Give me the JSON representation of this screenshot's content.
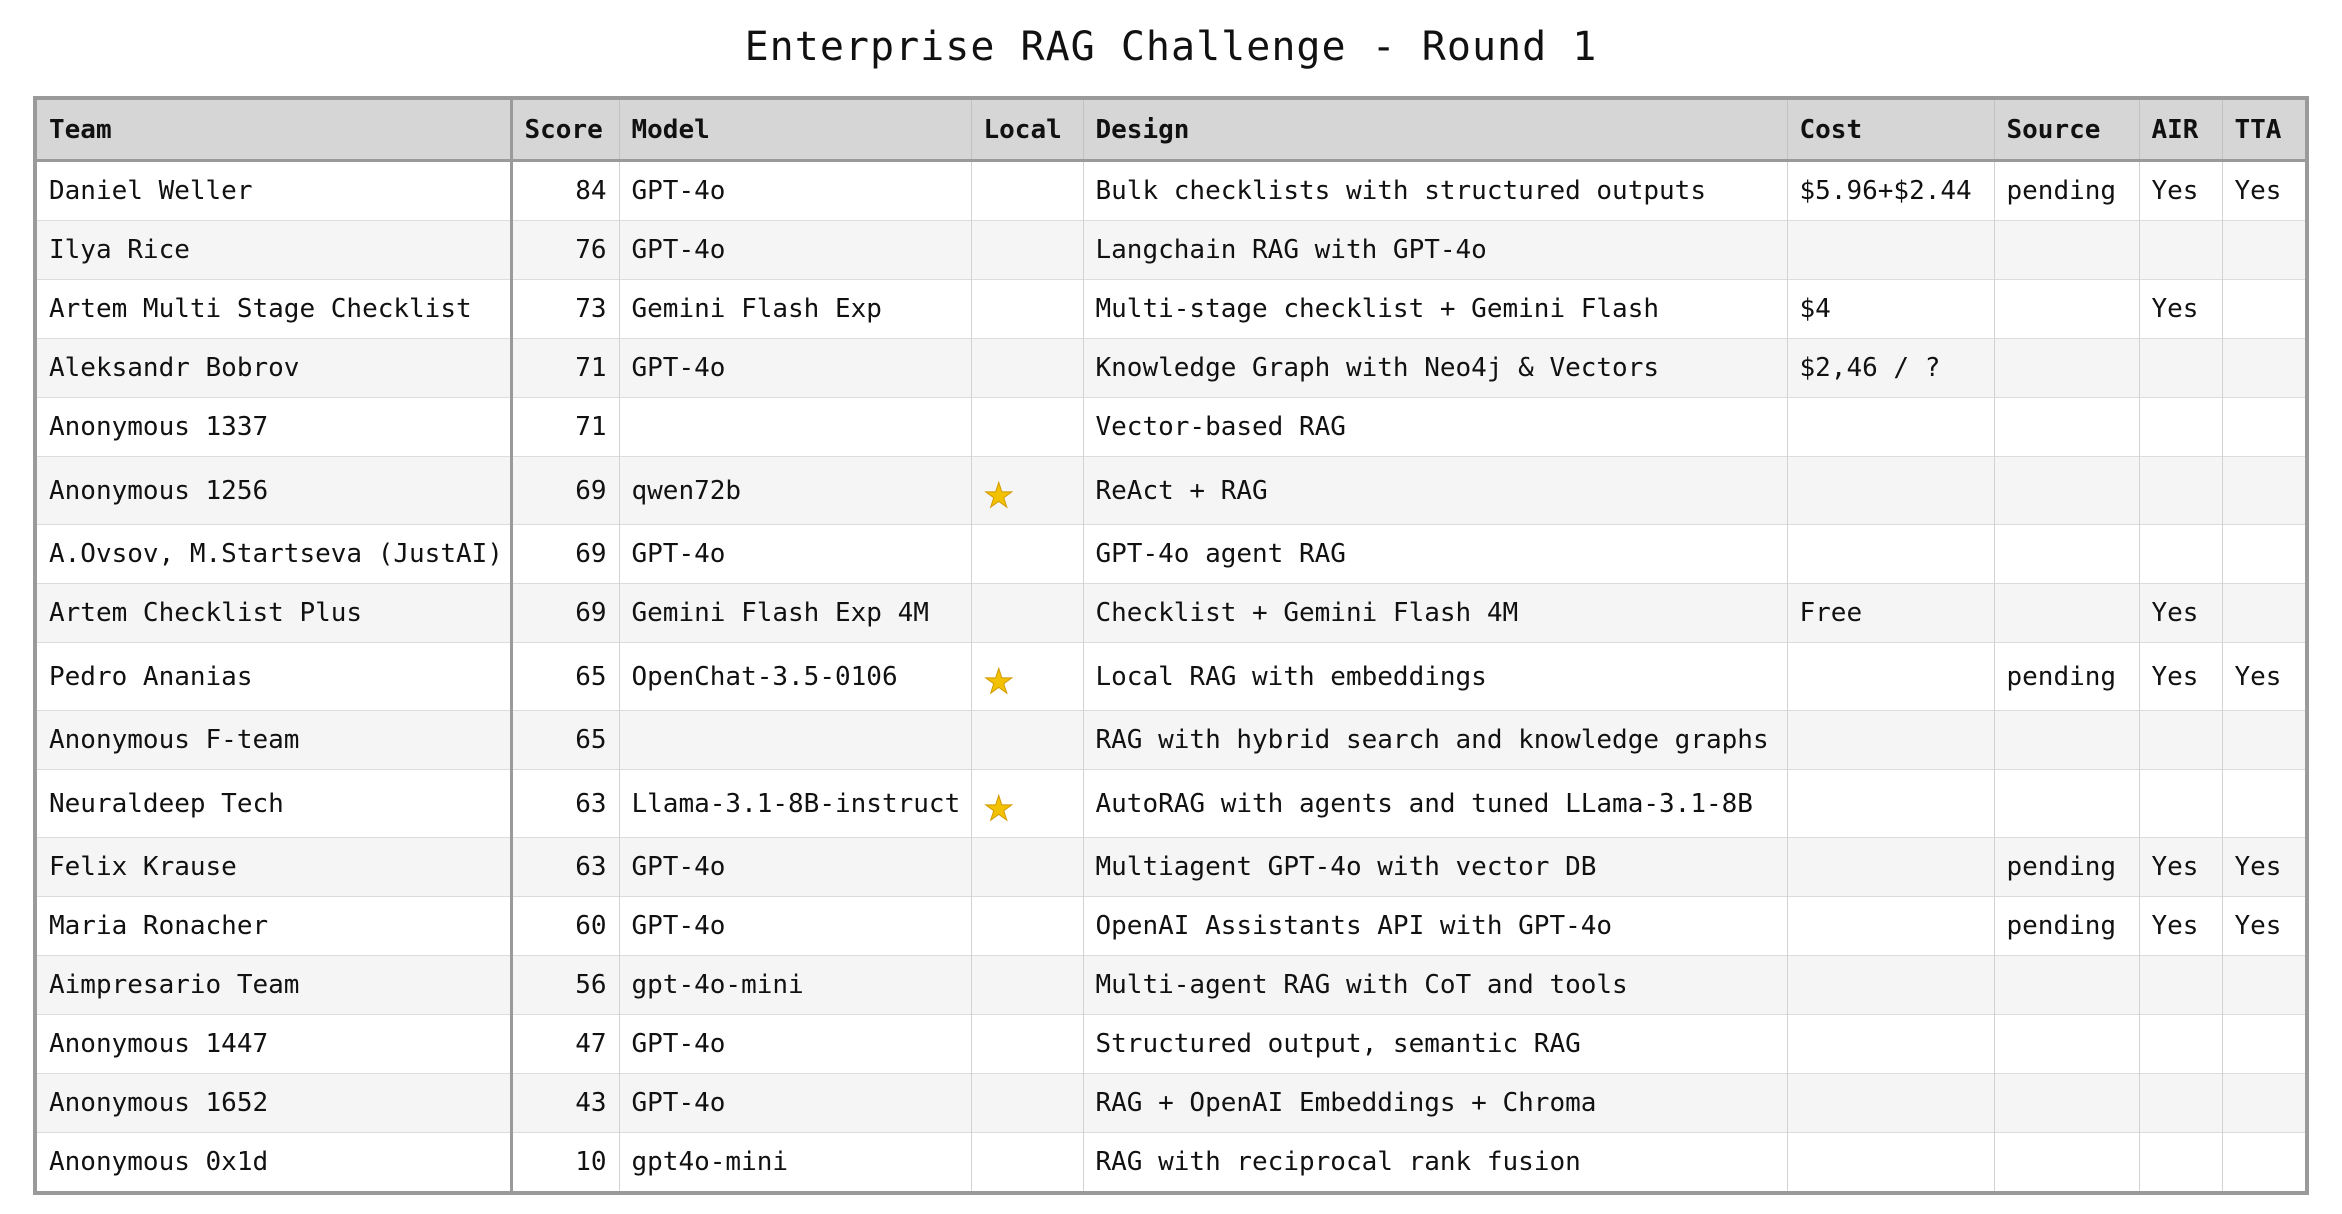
{
  "title": "Enterprise RAG Challenge - Round 1",
  "star_color": "#f2c200",
  "columns": [
    "Team",
    "Score",
    "Model",
    "Local",
    "Design",
    "Cost",
    "Source",
    "AIR",
    "TTA"
  ],
  "rows": [
    {
      "team": "Daniel Weller",
      "score": "84",
      "model": "GPT-4o",
      "local": false,
      "design": "Bulk checklists with structured outputs",
      "cost": "$5.96+$2.44",
      "source": "pending",
      "air": "Yes",
      "tta": "Yes"
    },
    {
      "team": "Ilya Rice",
      "score": "76",
      "model": "GPT-4o",
      "local": false,
      "design": "Langchain RAG with GPT-4o",
      "cost": "",
      "source": "",
      "air": "",
      "tta": ""
    },
    {
      "team": "Artem Multi Stage Checklist",
      "score": "73",
      "model": "Gemini Flash Exp",
      "local": false,
      "design": "Multi-stage checklist + Gemini Flash",
      "cost": "$4",
      "source": "",
      "air": "Yes",
      "tta": ""
    },
    {
      "team": "Aleksandr Bobrov",
      "score": "71",
      "model": "GPT-4o",
      "local": false,
      "design": "Knowledge Graph with Neo4j & Vectors",
      "cost": "$2,46 / ?",
      "source": "",
      "air": "",
      "tta": ""
    },
    {
      "team": "Anonymous 1337",
      "score": "71",
      "model": "",
      "local": false,
      "design": "Vector-based RAG",
      "cost": "",
      "source": "",
      "air": "",
      "tta": ""
    },
    {
      "team": "Anonymous 1256",
      "score": "69",
      "model": "qwen72b",
      "local": true,
      "design": "ReAct + RAG",
      "cost": "",
      "source": "",
      "air": "",
      "tta": ""
    },
    {
      "team": "A.Ovsov, M.Startseva (JustAI)",
      "score": "69",
      "model": "GPT-4o",
      "local": false,
      "design": "GPT-4o agent RAG",
      "cost": "",
      "source": "",
      "air": "",
      "tta": ""
    },
    {
      "team": "Artem Checklist Plus",
      "score": "69",
      "model": "Gemini Flash Exp 4M",
      "local": false,
      "design": "Checklist + Gemini Flash 4M",
      "cost": "Free",
      "source": "",
      "air": "Yes",
      "tta": ""
    },
    {
      "team": "Pedro Ananias",
      "score": "65",
      "model": "OpenChat-3.5-0106",
      "local": true,
      "design": "Local RAG with embeddings",
      "cost": "",
      "source": "pending",
      "air": "Yes",
      "tta": "Yes"
    },
    {
      "team": "Anonymous F-team",
      "score": "65",
      "model": "",
      "local": false,
      "design": "RAG with hybrid search and knowledge graphs",
      "cost": "",
      "source": "",
      "air": "",
      "tta": ""
    },
    {
      "team": "Neuraldeep Tech",
      "score": "63",
      "model": "Llama-3.1-8B-instruct",
      "local": true,
      "design": "AutoRAG with agents and tuned LLama-3.1-8B",
      "cost": "",
      "source": "",
      "air": "",
      "tta": ""
    },
    {
      "team": "Felix Krause",
      "score": "63",
      "model": "GPT-4o",
      "local": false,
      "design": "Multiagent GPT-4o with vector DB",
      "cost": "",
      "source": "pending",
      "air": "Yes",
      "tta": "Yes"
    },
    {
      "team": "Maria Ronacher",
      "score": "60",
      "model": "GPT-4o",
      "local": false,
      "design": "OpenAI Assistants API with GPT-4o",
      "cost": "",
      "source": "pending",
      "air": "Yes",
      "tta": "Yes"
    },
    {
      "team": "Aimpresario Team",
      "score": "56",
      "model": "gpt-4o-mini",
      "local": false,
      "design": "Multi-agent RAG with CoT and tools",
      "cost": "",
      "source": "",
      "air": "",
      "tta": ""
    },
    {
      "team": "Anonymous 1447",
      "score": "47",
      "model": "GPT-4o",
      "local": false,
      "design": "Structured output, semantic RAG",
      "cost": "",
      "source": "",
      "air": "",
      "tta": ""
    },
    {
      "team": "Anonymous 1652",
      "score": "43",
      "model": "GPT-4o",
      "local": false,
      "design": "RAG + OpenAI Embeddings + Chroma",
      "cost": "",
      "source": "",
      "air": "",
      "tta": ""
    },
    {
      "team": "Anonymous 0x1d",
      "score": "10",
      "model": "gpt4o-mini",
      "local": false,
      "design": "RAG with reciprocal rank fusion",
      "cost": "",
      "source": "",
      "air": "",
      "tta": ""
    }
  ]
}
